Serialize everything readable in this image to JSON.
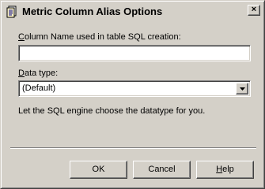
{
  "window": {
    "title": "Metric Column Alias Options",
    "title_icon": "document-icon",
    "close_glyph": "×"
  },
  "column_name": {
    "label_prefix": "",
    "label_mnemonic": "C",
    "label_rest": "olumn Name used in table SQL creation:",
    "value": ""
  },
  "data_type": {
    "label_prefix": "",
    "label_mnemonic": "D",
    "label_rest": "ata type:",
    "selected": "(Default)",
    "description": "Let the SQL engine choose the datatype for you."
  },
  "buttons": {
    "ok_label": "OK",
    "cancel_label": "Cancel",
    "help_prefix": "",
    "help_mnemonic": "H",
    "help_rest": "elp"
  }
}
